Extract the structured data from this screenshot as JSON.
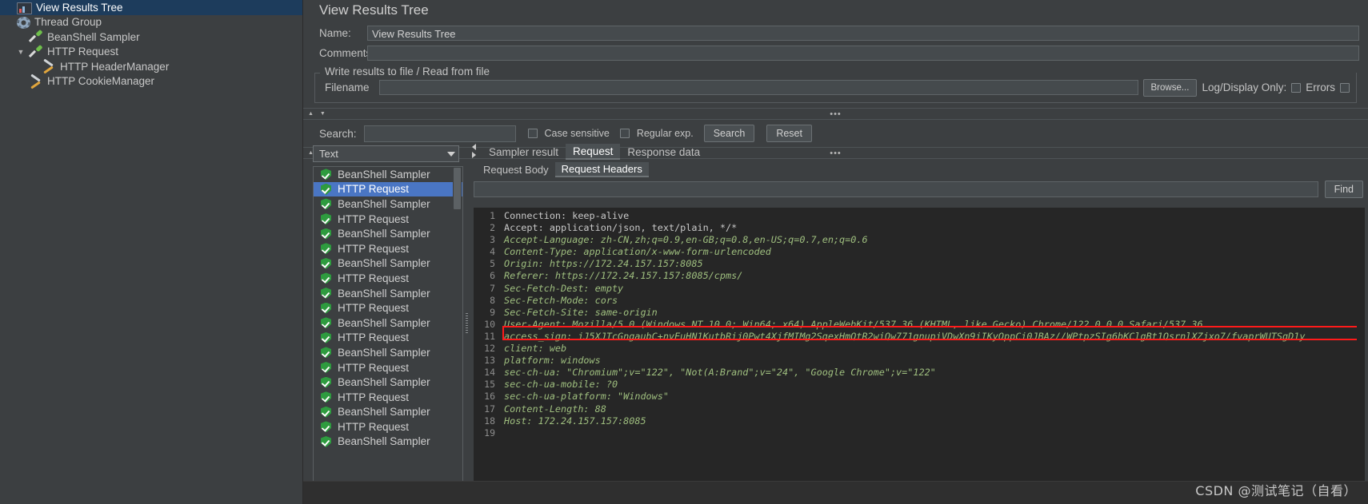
{
  "tree": {
    "items": [
      {
        "label": "View Results Tree",
        "icon": "results-icon",
        "indent": 0,
        "selected": true,
        "toggle": ""
      },
      {
        "label": "Thread Group",
        "icon": "gear-icon",
        "indent": 0,
        "selected": false,
        "toggle": ""
      },
      {
        "label": "BeanShell Sampler",
        "icon": "pipette-icon",
        "indent": 1,
        "selected": false,
        "toggle": ""
      },
      {
        "label": "HTTP Request",
        "icon": "pipette-icon",
        "indent": 1,
        "selected": false,
        "toggle": "v"
      },
      {
        "label": "HTTP HeaderManager",
        "icon": "tools-icon",
        "indent": 2,
        "selected": false,
        "toggle": ""
      },
      {
        "label": "HTTP CookieManager",
        "icon": "tools-icon",
        "indent": 1,
        "selected": false,
        "toggle": ""
      }
    ]
  },
  "header": {
    "title": "View Results Tree",
    "name_label": "Name:",
    "name_value": "View Results Tree",
    "comments_label": "Comments:",
    "comments_value": ""
  },
  "file_group": {
    "legend": "Write results to file / Read from file",
    "filename_label": "Filename",
    "filename_value": "",
    "browse_label": "Browse...",
    "log_display_label": "Log/Display Only:",
    "errors_label": "Errors"
  },
  "search_bar": {
    "label": "Search:",
    "value": "",
    "case_sensitive_label": "Case sensitive",
    "regular_exp_label": "Regular exp.",
    "search_button": "Search",
    "reset_button": "Reset"
  },
  "render_selector": {
    "value": "Text"
  },
  "result_list": {
    "items": [
      {
        "label": "BeanShell Sampler",
        "selected": false
      },
      {
        "label": "HTTP Request",
        "selected": true
      },
      {
        "label": "BeanShell Sampler",
        "selected": false
      },
      {
        "label": "HTTP Request",
        "selected": false
      },
      {
        "label": "BeanShell Sampler",
        "selected": false
      },
      {
        "label": "HTTP Request",
        "selected": false
      },
      {
        "label": "BeanShell Sampler",
        "selected": false
      },
      {
        "label": "HTTP Request",
        "selected": false
      },
      {
        "label": "BeanShell Sampler",
        "selected": false
      },
      {
        "label": "HTTP Request",
        "selected": false
      },
      {
        "label": "BeanShell Sampler",
        "selected": false
      },
      {
        "label": "HTTP Request",
        "selected": false
      },
      {
        "label": "BeanShell Sampler",
        "selected": false
      },
      {
        "label": "HTTP Request",
        "selected": false
      },
      {
        "label": "BeanShell Sampler",
        "selected": false
      },
      {
        "label": "HTTP Request",
        "selected": false
      },
      {
        "label": "BeanShell Sampler",
        "selected": false
      },
      {
        "label": "HTTP Request",
        "selected": false
      },
      {
        "label": "BeanShell Sampler",
        "selected": false
      }
    ]
  },
  "tabs": {
    "primary": [
      {
        "label": "Sampler result",
        "active": false
      },
      {
        "label": "Request",
        "active": true
      },
      {
        "label": "Response data",
        "active": false
      }
    ],
    "secondary": [
      {
        "label": "Request Body",
        "active": false
      },
      {
        "label": "Request Headers",
        "active": true
      }
    ]
  },
  "find_bar": {
    "value": "",
    "button": "Find"
  },
  "code": {
    "lines": [
      {
        "n": "1",
        "text": "Connection: keep-alive",
        "style": "plain"
      },
      {
        "n": "2",
        "text": "Accept: application/json, text/plain, */*",
        "style": "plain"
      },
      {
        "n": "3",
        "text": "Accept-Language: zh-CN,zh;q=0.9,en-GB;q=0.8,en-US;q=0.7,en;q=0.6",
        "style": "green"
      },
      {
        "n": "4",
        "text": "Content-Type: application/x-www-form-urlencoded",
        "style": "green"
      },
      {
        "n": "5",
        "text": "Origin: https://172.24.157.157:8085",
        "style": "green-link",
        "prefix": "Origin: ",
        "link": "https://172.24.157.157:8085"
      },
      {
        "n": "6",
        "text": "Referer: https://172.24.157.157:8085/cpms/",
        "style": "green-link",
        "prefix": "Referer: ",
        "link": "https://172.24.157.157:8085/cpms/"
      },
      {
        "n": "7",
        "text": "Sec-Fetch-Dest: empty",
        "style": "green"
      },
      {
        "n": "8",
        "text": "Sec-Fetch-Mode: cors",
        "style": "green"
      },
      {
        "n": "9",
        "text": "Sec-Fetch-Site: same-origin",
        "style": "green"
      },
      {
        "n": "10",
        "text": "User-Agent: Mozilla/5.0 (Windows NT 10.0; Win64; x64) AppleWebKit/537.36 (KHTML, like Gecko) Chrome/122.0.0.0 Safari/537.36",
        "style": "green"
      },
      {
        "n": "11",
        "text": "access_sign: iJ5XJTcGngaubC+nvEuHN1KutbRij0Pwt4XjfMIMg2SqexHmQtR2wiQw771gnupiVDwXn9iIKyOppCi0JBAz//WPtpzSIg6bKClgBt1QsrnlXZjxo7/fvaprWUTSgD1y",
        "style": "green",
        "highlighted": true
      },
      {
        "n": "12",
        "text": "client: web",
        "style": "green"
      },
      {
        "n": "13",
        "text": "platform: windows",
        "style": "green"
      },
      {
        "n": "14",
        "text": "sec-ch-ua: \"Chromium\";v=\"122\", \"Not(A:Brand\";v=\"24\", \"Google Chrome\";v=\"122\"",
        "style": "green"
      },
      {
        "n": "15",
        "text": "sec-ch-ua-mobile: ?0",
        "style": "green"
      },
      {
        "n": "16",
        "text": "sec-ch-ua-platform: \"Windows\"",
        "style": "green"
      },
      {
        "n": "17",
        "text": "Content-Length: 88",
        "style": "green"
      },
      {
        "n": "18",
        "text": "Host: 172.24.157.157:8085",
        "style": "green"
      },
      {
        "n": "19",
        "text": "",
        "style": "green"
      }
    ]
  },
  "watermark": {
    "text": "CSDN @测试笔记（自看）"
  },
  "colors": {
    "panel_bg": "#3c3f41",
    "tree_selected": "#1d3c5c",
    "list_selected": "#4a76c4",
    "code_bg": "#262626",
    "code_green": "#9fbf7f",
    "highlight_red": "#ff1a1a",
    "shield_green": "#2e9b3f"
  }
}
